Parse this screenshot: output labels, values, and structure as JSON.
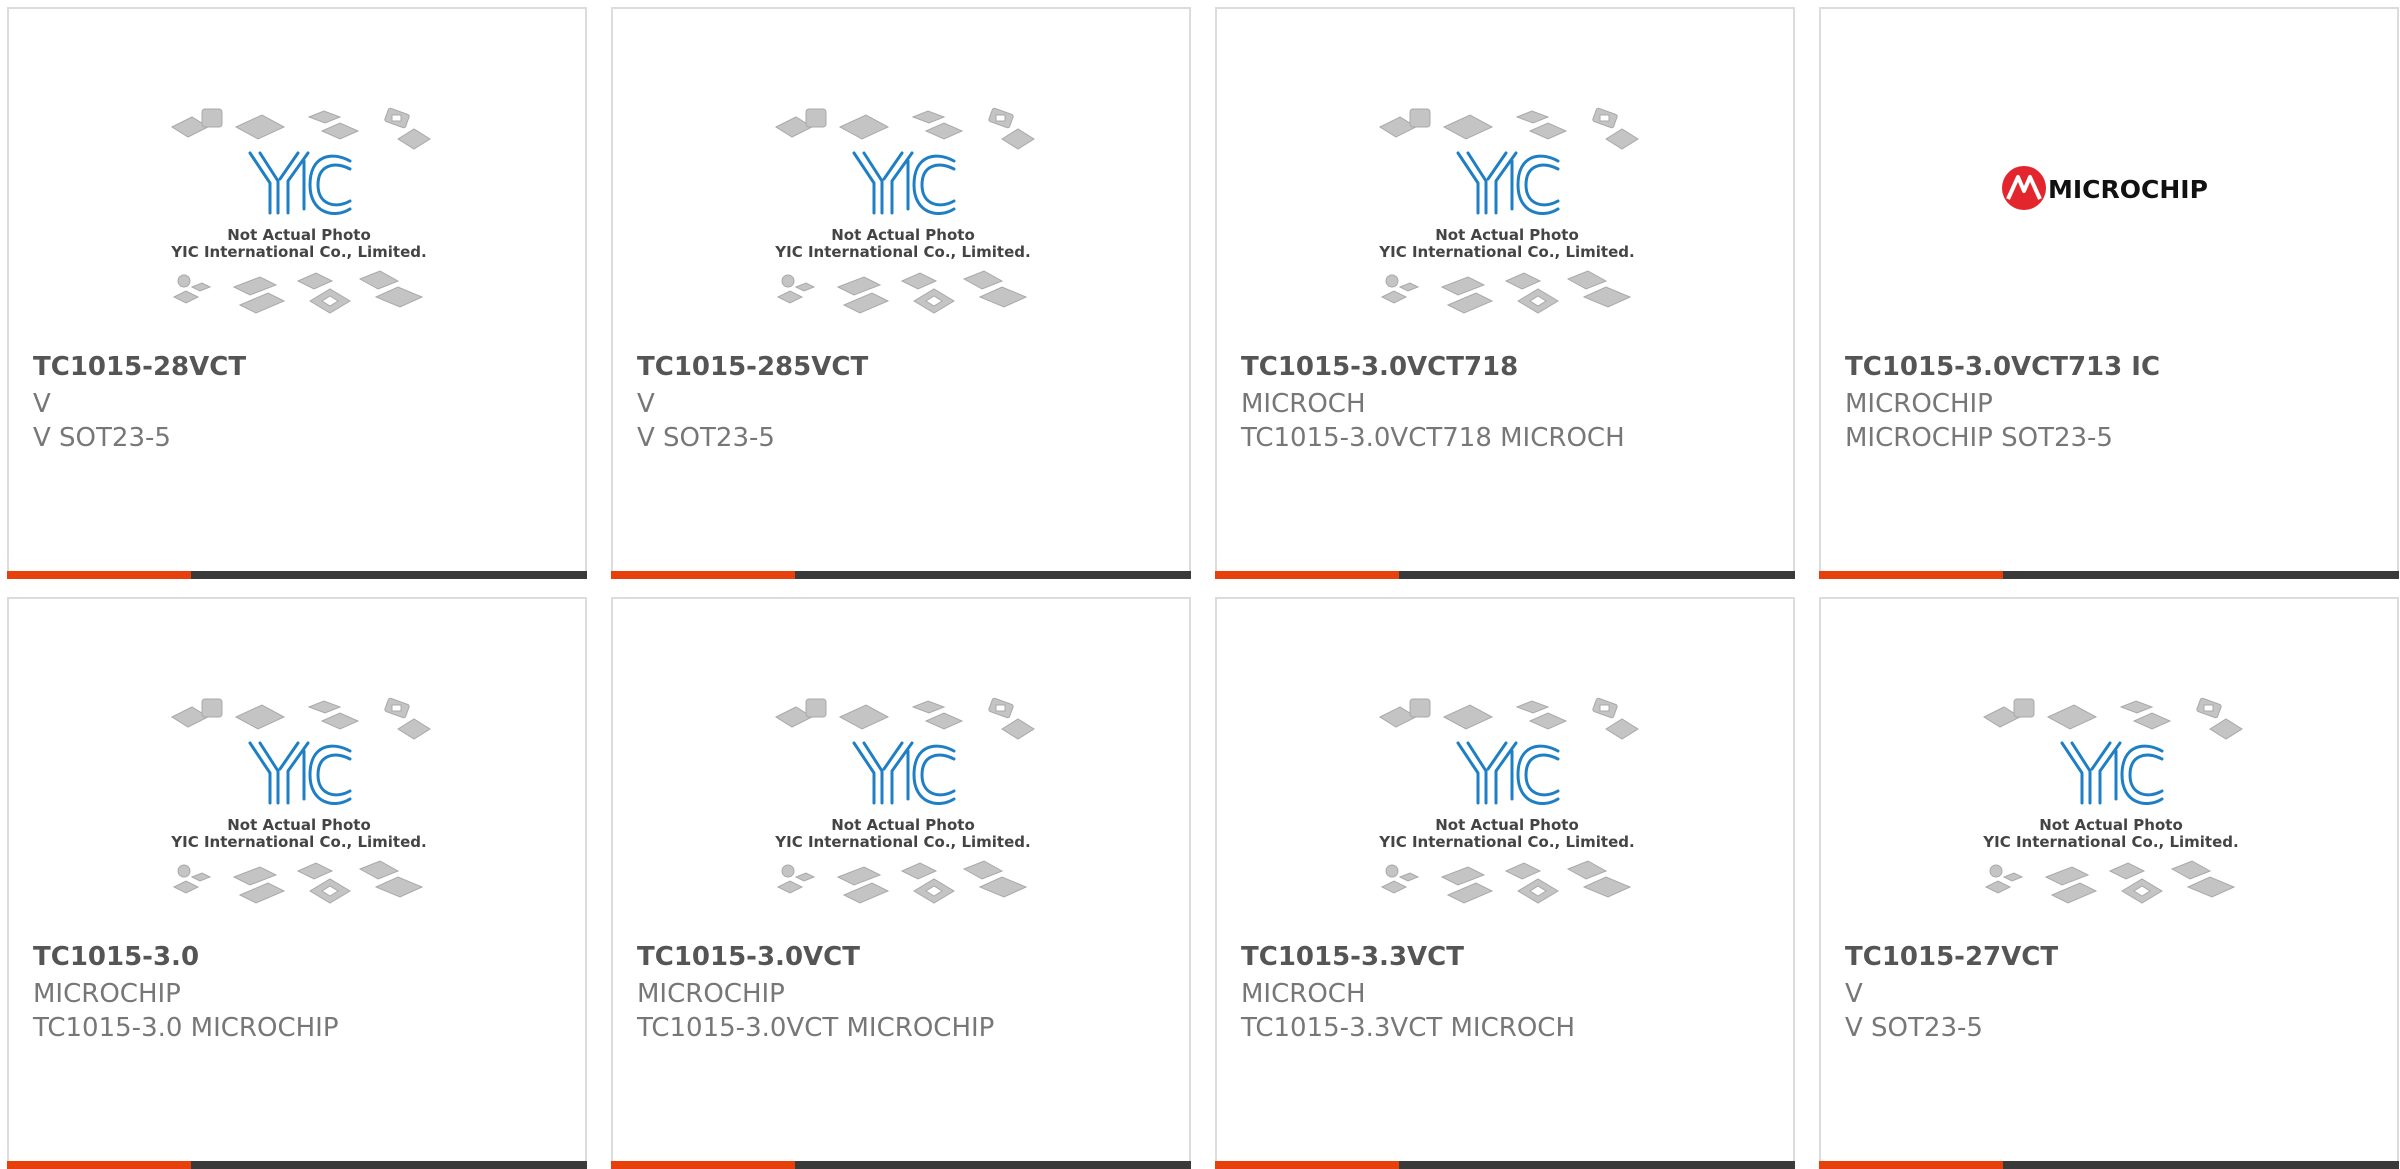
{
  "placeholder_caption": {
    "line1": "Not Actual Photo",
    "line2": "YIC International Co., Limited."
  },
  "logo_text": {
    "yic": "YIC",
    "microchip": "MICROCHIP"
  },
  "colors": {
    "accent": "#e8400c",
    "bar": "#3a3a3a",
    "title": "#555555",
    "text": "#777777",
    "yic_blue": "#1f7fc4",
    "microchip_red": "#e3262e"
  },
  "products": [
    {
      "part": "TC1015-28VCT",
      "manufacturer": "V",
      "description": "V SOT23-5",
      "image": "yic-placeholder"
    },
    {
      "part": "TC1015-285VCT",
      "manufacturer": "V",
      "description": "V SOT23-5",
      "image": "yic-placeholder"
    },
    {
      "part": "TC1015-3.0VCT718",
      "manufacturer": "MICROCH",
      "description": "TC1015-3.0VCT718 MICROCH",
      "image": "yic-placeholder"
    },
    {
      "part": "TC1015-3.0VCT713 IC",
      "manufacturer": "MICROCHIP",
      "description": "MICROCHIP SOT23-5",
      "image": "microchip-logo"
    },
    {
      "part": "TC1015-3.0",
      "manufacturer": "MICROCHIP",
      "description": "TC1015-3.0 MICROCHIP",
      "image": "yic-placeholder"
    },
    {
      "part": "TC1015-3.0VCT",
      "manufacturer": "MICROCHIP",
      "description": "TC1015-3.0VCT MICROCHIP",
      "image": "yic-placeholder"
    },
    {
      "part": "TC1015-3.3VCT",
      "manufacturer": "MICROCH",
      "description": "TC1015-3.3VCT MICROCH",
      "image": "yic-placeholder"
    },
    {
      "part": "TC1015-27VCT",
      "manufacturer": "V",
      "description": "V SOT23-5",
      "image": "yic-placeholder"
    }
  ]
}
